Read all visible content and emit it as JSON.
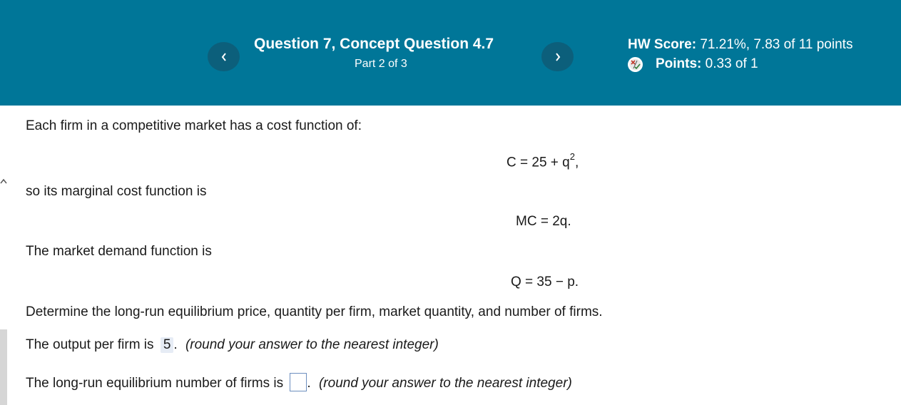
{
  "header": {
    "question_title": "Question 7, Concept Question 4.7",
    "part_label": "Part 2 of 3",
    "prev_icon": "chevron-left-icon",
    "next_icon": "chevron-right-icon",
    "hw_score_label": "HW Score:",
    "hw_score_value": "71.21%, 7.83 of 11 points",
    "points_label": "Points:",
    "points_value": "0.33 of 1",
    "points_icon": "partial-credit-icon",
    "colors": {
      "header_bg": "#007698",
      "nav_btn_bg": "#0c5f7b"
    }
  },
  "content": {
    "intro": "Each firm in a competitive market has a cost function of:",
    "cost_eq_main": "C = 25 + q",
    "cost_eq_exp": "2",
    "cost_eq_suffix": ",",
    "mc_intro": "so its marginal cost function is",
    "mc_eq": "MC = 2q.",
    "demand_intro": "The market demand function is",
    "demand_eq": "Q = 35 − p.",
    "task": "Determine the long-run equilibrium price, quantity per firm, market quantity, and number of firms.",
    "q1_prefix": "The output per firm is",
    "q1_answer": "5",
    "q1_suffix": ".",
    "q1_hint": "(round your answer to the nearest integer)",
    "q2_prefix": "The long-run equilibrium number of firms is",
    "q2_suffix": ".",
    "q2_hint": "(round your answer to the nearest integer)"
  }
}
